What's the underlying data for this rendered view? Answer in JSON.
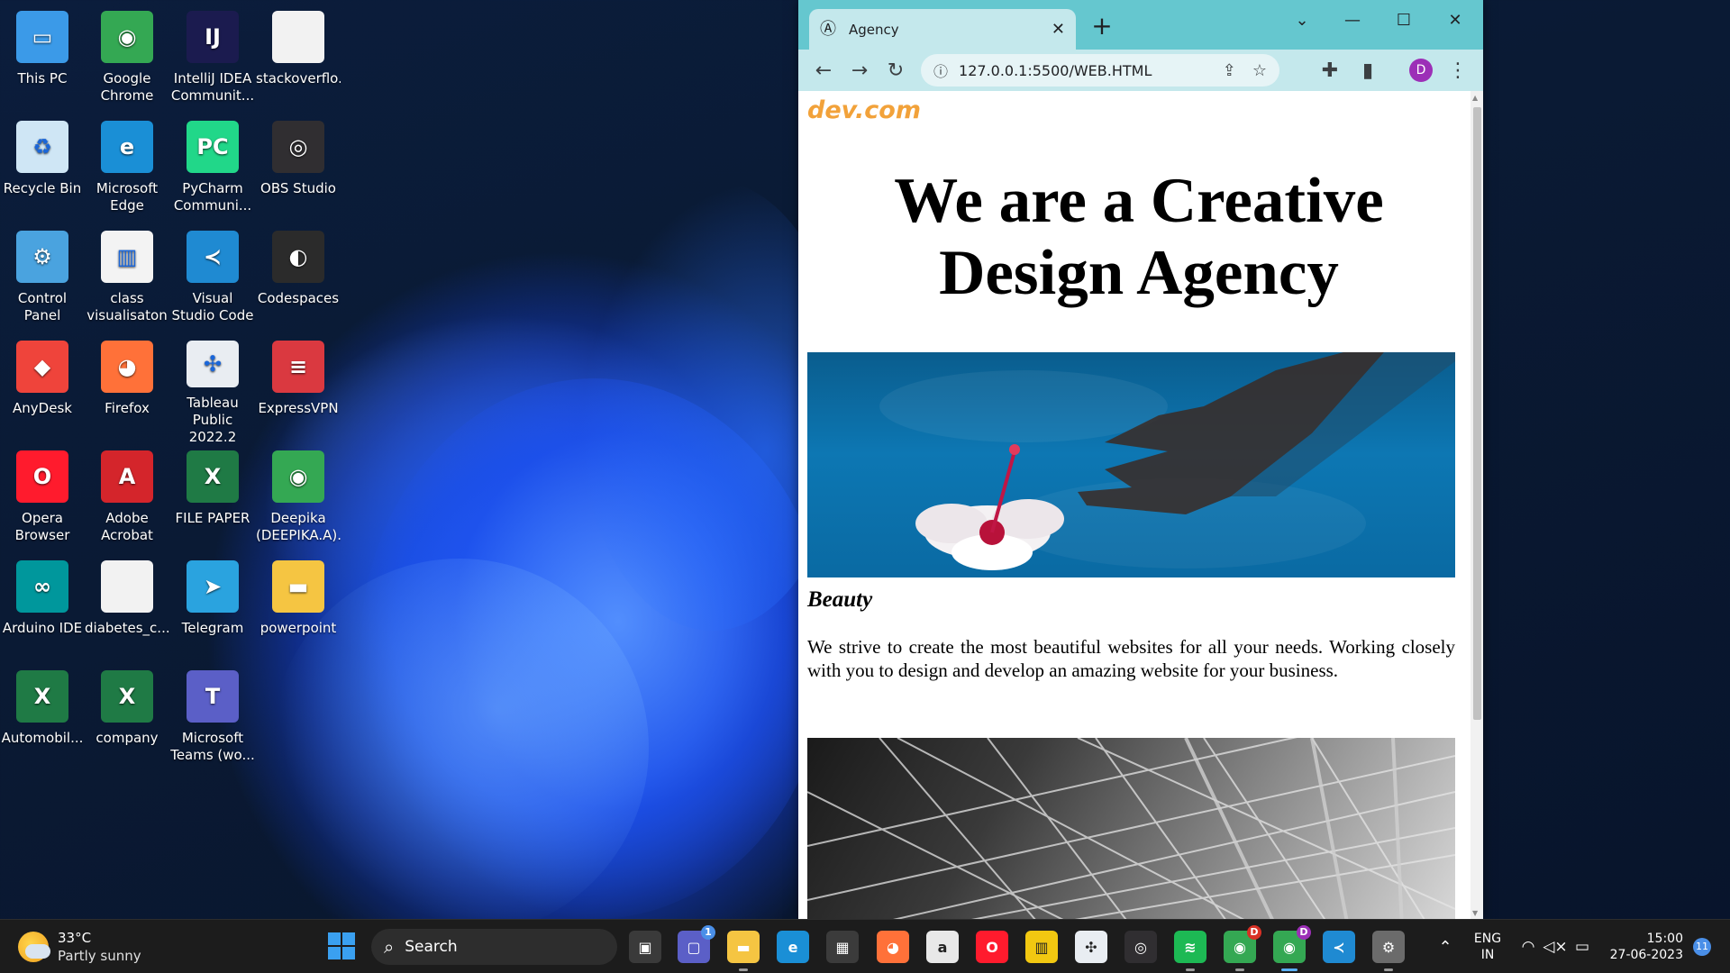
{
  "desktop": {
    "icons": [
      {
        "label": "This PC",
        "icon": "this-pc-icon",
        "color": "#3b9ae8",
        "glyph": "▭"
      },
      {
        "label": "Google Chrome",
        "icon": "chrome-icon",
        "color": "#34a853",
        "glyph": "◉"
      },
      {
        "label": "IntelliJ IDEA Communit...",
        "icon": "intellij-icon",
        "color": "#1b1b4f",
        "glyph": "IJ"
      },
      {
        "label": "stackoverflo...",
        "icon": "file-icon",
        "color": "#f2f2f2",
        "glyph": ""
      },
      {
        "label": "Recycle Bin",
        "icon": "recycle-bin-icon",
        "color": "#cfe6f5",
        "glyph": "♻"
      },
      {
        "label": "Microsoft Edge",
        "icon": "edge-icon",
        "color": "#1a8fd6",
        "glyph": "e"
      },
      {
        "label": "PyCharm Communi...",
        "icon": "pycharm-icon",
        "color": "#21d789",
        "glyph": "PC"
      },
      {
        "label": "OBS Studio",
        "icon": "obs-icon",
        "color": "#302e31",
        "glyph": "◎"
      },
      {
        "label": "Control Panel",
        "icon": "control-panel-icon",
        "color": "#4aa3df",
        "glyph": "⚙"
      },
      {
        "label": "class visualisaton",
        "icon": "powerbi-file-icon",
        "color": "#f3f3f3",
        "glyph": "▥"
      },
      {
        "label": "Visual Studio Code",
        "icon": "vscode-icon",
        "color": "#1f8ad2",
        "glyph": "≺"
      },
      {
        "label": "Codespaces",
        "icon": "codespaces-icon",
        "color": "#2b2b2b",
        "glyph": "◐"
      },
      {
        "label": "AnyDesk",
        "icon": "anydesk-icon",
        "color": "#ef443b",
        "glyph": "◆"
      },
      {
        "label": "Firefox",
        "icon": "firefox-icon",
        "color": "#ff7139",
        "glyph": "◕"
      },
      {
        "label": "Tableau Public 2022.2",
        "icon": "tableau-icon",
        "color": "#e9edf2",
        "glyph": "✣"
      },
      {
        "label": "ExpressVPN",
        "icon": "expressvpn-icon",
        "color": "#da3940",
        "glyph": "≡"
      },
      {
        "label": "Opera Browser",
        "icon": "opera-icon",
        "color": "#ff1b2d",
        "glyph": "O"
      },
      {
        "label": "Adobe Acrobat",
        "icon": "acrobat-icon",
        "color": "#d4252b",
        "glyph": "A"
      },
      {
        "label": "FILE PAPER",
        "icon": "excel-file-icon",
        "color": "#1f7a45",
        "glyph": "X"
      },
      {
        "label": "Deepika (DEEPIKA.A)...",
        "icon": "chrome-profile-icon",
        "color": "#34a853",
        "glyph": "◉"
      },
      {
        "label": "Arduino IDE",
        "icon": "arduino-icon",
        "color": "#00979c",
        "glyph": "∞"
      },
      {
        "label": "diabetes_c...",
        "icon": "file-icon",
        "color": "#f2f2f2",
        "glyph": ""
      },
      {
        "label": "Telegram",
        "icon": "telegram-icon",
        "color": "#2aa3df",
        "glyph": "➤"
      },
      {
        "label": "powerpoint",
        "icon": "folder-icon",
        "color": "#f5c542",
        "glyph": "▬"
      },
      {
        "label": "Automobil...",
        "icon": "excel-file-icon",
        "color": "#1f7a45",
        "glyph": "X"
      },
      {
        "label": "company",
        "icon": "excel-file-icon",
        "color": "#1f7a45",
        "glyph": "X"
      },
      {
        "label": "Microsoft Teams (wo...",
        "icon": "teams-icon",
        "color": "#5b5fc7",
        "glyph": "T"
      }
    ]
  },
  "browser": {
    "tab_title": "Agency",
    "url": "127.0.0.1:5500/WEB.HTML",
    "profile_initial": "D",
    "titlebar_color": "#65c7cf",
    "toolbar_color": "#c4e8ec"
  },
  "page": {
    "logo": "dev.com",
    "logo_color": "#f2a23a",
    "hero_title": "We are a Creative Design Agency",
    "section_title": "Beauty",
    "section_text": "We strive to create the most beautiful websites for all your needs. Working closely with you to design and develop an amazing website for your business."
  },
  "taskbar": {
    "weather_temp": "33°C",
    "weather_condition": "Partly sunny",
    "search_label": "Search",
    "apps": [
      {
        "name": "task-view-icon",
        "glyph": "▣",
        "color": "#3a3a3a",
        "dot": false,
        "active": false
      },
      {
        "name": "teams-chat-icon",
        "glyph": "▢",
        "color": "#5b5fc7",
        "dot": false,
        "active": false,
        "badge": "1"
      },
      {
        "name": "file-explorer-icon",
        "glyph": "▬",
        "color": "#f5c542",
        "dot": true,
        "active": false
      },
      {
        "name": "edge-icon",
        "glyph": "e",
        "color": "#1a8fd6",
        "dot": false,
        "active": false
      },
      {
        "name": "microsoft-store-icon",
        "glyph": "▦",
        "color": "#3b3b3b",
        "dot": false,
        "active": false
      },
      {
        "name": "firefox-icon",
        "glyph": "◕",
        "color": "#ff7139",
        "dot": false,
        "active": false
      },
      {
        "name": "amazon-icon",
        "glyph": "a",
        "color": "#e8e8e8",
        "dot": false,
        "active": false
      },
      {
        "name": "opera-icon",
        "glyph": "O",
        "color": "#ff1b2d",
        "dot": false,
        "active": false
      },
      {
        "name": "powerbi-icon",
        "glyph": "▥",
        "color": "#f2c811",
        "dot": false,
        "active": false
      },
      {
        "name": "tableau-icon",
        "glyph": "✣",
        "color": "#e9edf2",
        "dot": false,
        "active": false
      },
      {
        "name": "obs-icon",
        "glyph": "◎",
        "color": "#302e31",
        "dot": false,
        "active": false
      },
      {
        "name": "spotify-icon",
        "glyph": "≋",
        "color": "#1db954",
        "dot": true,
        "active": false
      },
      {
        "name": "chrome-icon",
        "glyph": "◉",
        "color": "#34a853",
        "dot": true,
        "active": false,
        "badge": "D"
      },
      {
        "name": "chrome-profile-icon",
        "glyph": "◉",
        "color": "#34a853",
        "dot": true,
        "active": true,
        "badge": "D"
      },
      {
        "name": "vscode-icon",
        "glyph": "≺",
        "color": "#1f8ad2",
        "dot": false,
        "active": false
      },
      {
        "name": "settings-icon",
        "glyph": "⚙",
        "color": "#6b6b6b",
        "dot": true,
        "active": false
      }
    ],
    "language": "ENG",
    "region": "IN",
    "time": "15:00",
    "date": "27-06-2023",
    "notification_count": "11"
  }
}
